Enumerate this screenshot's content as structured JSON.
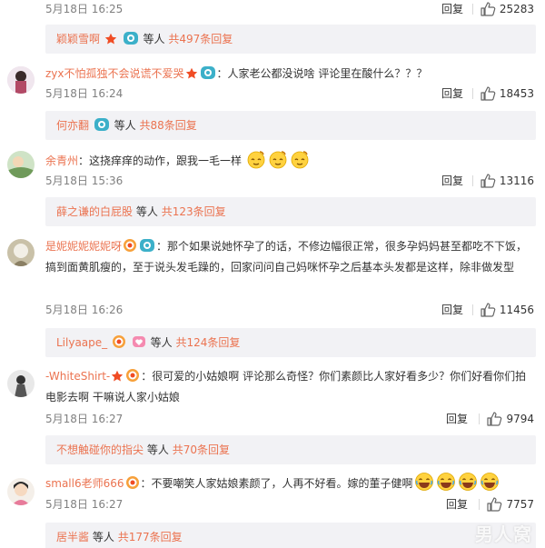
{
  "colors": {
    "name": "#eb7350",
    "text": "#333333",
    "meta": "#808080",
    "subbox_bg": "#f2f2f5"
  },
  "labels": {
    "reply": "回复",
    "separator": "：",
    "deng": "等人"
  },
  "top_meta": {
    "time": "5月18日 16:25",
    "likes": "25283"
  },
  "top_sub": {
    "user": "颖颖雪啊",
    "more": "共497条回复"
  },
  "comments": [
    {
      "user": "zyx不怕孤独不会说谎不爱哭",
      "text": "人家老公都没说啥 评论里在酸什么？？？",
      "time": "5月18日 16:24",
      "likes": "18453",
      "sub_user": "何亦翻",
      "sub_more": "共88条回复"
    },
    {
      "user": "余青州",
      "text": "这挠痒痒的动作，跟我一毛一样",
      "time": "5月18日 15:36",
      "likes": "13116",
      "sub_user": "薛之谦的白屁股",
      "sub_more": "共123条回复"
    },
    {
      "user": "是妮妮妮妮妮呀",
      "text": "那个如果说她怀孕了的话，不修边幅很正常，很多孕妈妈甚至都吃不下饭，搞到面黄肌瘦的，至于说头发毛躁的，回家问问自己妈咪怀孕之后基本头发都是这样，除非做发型",
      "time": "5月18日 16:26",
      "likes": "11456",
      "sub_user": "Lilyaape_",
      "sub_more": "共124条回复"
    },
    {
      "user": "-WhiteShirt-",
      "text": "很可爱的小姑娘啊 评论那么奇怪？你们素颜比人家好看多少？你们好看你们拍电影去啊 干嘛说人家小姑娘",
      "time": "5月18日 16:27",
      "likes": "9794",
      "sub_user": "不想触碰你的指尖",
      "sub_more": "共70条回复"
    },
    {
      "user": "small6老师666",
      "text": "不要嘲笑人家姑娘素颜了，人再不好看。嫁的董子健啊",
      "time": "5月18日 16:27",
      "likes": "7757",
      "sub_user": "居半酱",
      "sub_more": "共177条回复"
    }
  ],
  "watermark": "男人窝"
}
